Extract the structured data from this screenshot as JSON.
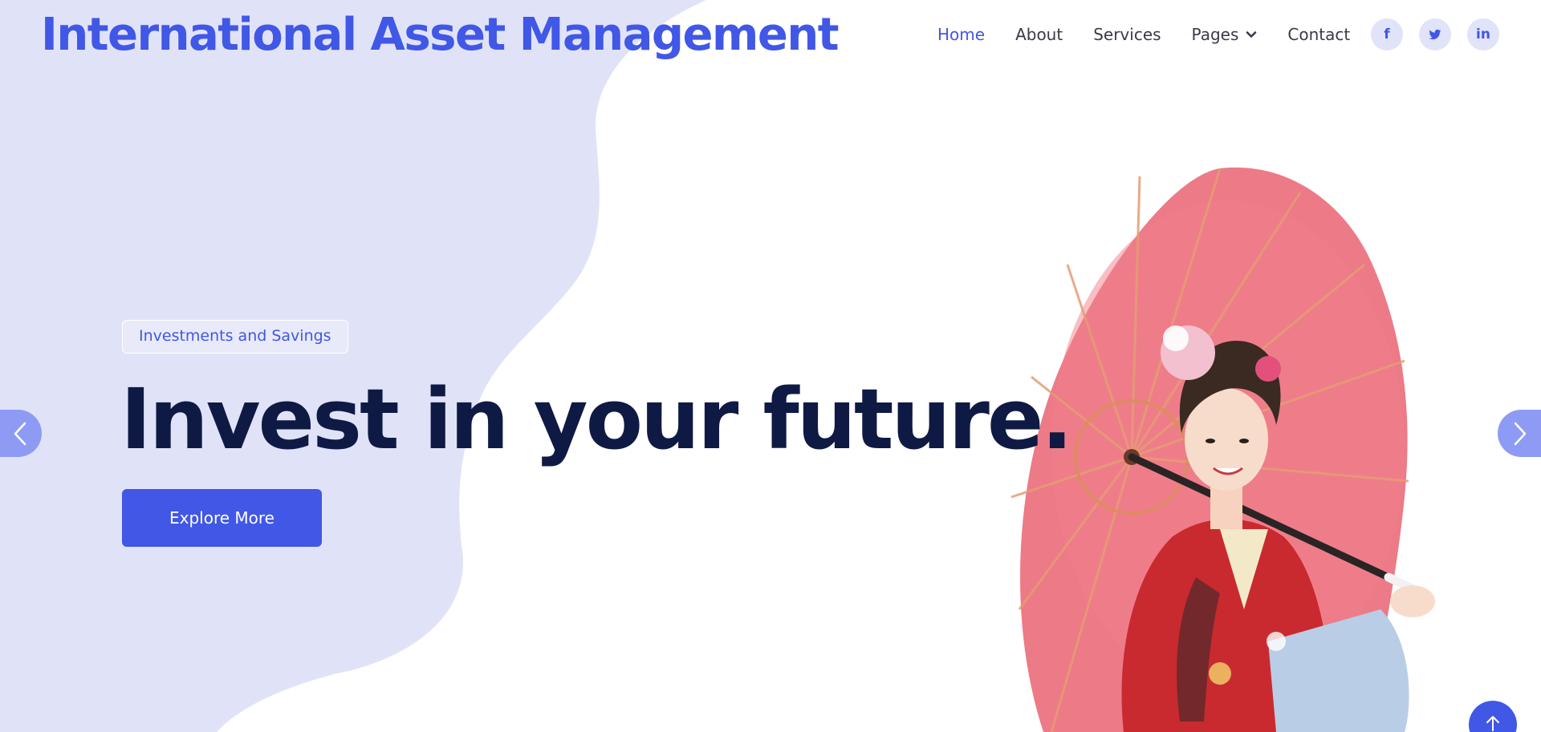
{
  "site": {
    "brand": "International Asset Management"
  },
  "nav": {
    "items": [
      {
        "label": "Home",
        "active": true
      },
      {
        "label": "About",
        "active": false
      },
      {
        "label": "Services",
        "active": false
      },
      {
        "label": "Pages",
        "active": false,
        "has_dropdown": true
      },
      {
        "label": "Contact",
        "active": false
      }
    ]
  },
  "social": [
    {
      "name": "facebook-icon",
      "glyph": "f"
    },
    {
      "name": "twitter-icon",
      "glyph": ""
    },
    {
      "name": "linkedin-icon",
      "glyph": "in"
    }
  ],
  "hero": {
    "tag": "Investments and Savings",
    "headline": "Invest in your future.",
    "cta_label": "Explore More"
  },
  "colors": {
    "accent": "#4157e6",
    "blob": "#e0e3f8",
    "headline": "#0f1a44",
    "arrow": "#8e9bf5"
  }
}
